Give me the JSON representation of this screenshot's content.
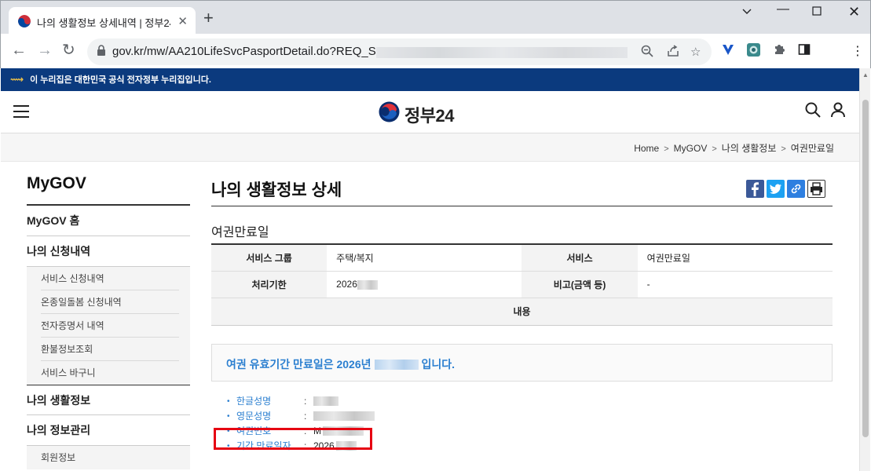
{
  "browser": {
    "tab_title": "나의 생활정보 상세내역 | 정부24",
    "url": "gov.kr/mw/AA210LifeSvcPasportDetail.do?REQ_SEQ="
  },
  "page": {
    "gov_banner": "이 누리집은 대한민국 공식 전자정부 누리집입니다.",
    "logo_text": "정부24",
    "breadcrumb": [
      "Home",
      "MyGOV",
      "나의 생활정보",
      "여권만료일"
    ],
    "sidebar": {
      "title": "MyGOV",
      "home": "MyGOV 홈",
      "section1": "나의 신청내역",
      "section1_items": [
        "서비스 신청내역",
        "온종일돌봄 신청내역",
        "전자증명서 내역",
        "환불정보조회",
        "서비스 바구니"
      ],
      "section2": "나의 생활정보",
      "section3": "나의 정보관리",
      "section3_items": [
        "회원정보"
      ]
    },
    "main": {
      "title": "나의 생활정보 상세",
      "subtitle": "여권만료일",
      "table": {
        "r1": {
          "h1": "서비스 그룹",
          "v1": "주택/복지",
          "h2": "서비스",
          "v2": "여권만료일"
        },
        "r2": {
          "h1": "처리기한",
          "v1": "2026",
          "h2": "비고(금액 등)",
          "v2": "-"
        },
        "content_header": "내용"
      },
      "notice_prefix": "여권 유효기간 만료일은 2026년",
      "notice_suffix": "입니다.",
      "details": [
        {
          "label": "한글성명",
          "value": ""
        },
        {
          "label": "영문성명",
          "value": ""
        },
        {
          "label": "여권번호",
          "value": "M"
        },
        {
          "label": "기간 만료일자",
          "value": "2026"
        }
      ],
      "details_colon": ":"
    }
  },
  "colors": {
    "gov_banner": "#0b3a7e",
    "accent_blue": "#2b7fd0",
    "highlight_red": "#e60012"
  }
}
